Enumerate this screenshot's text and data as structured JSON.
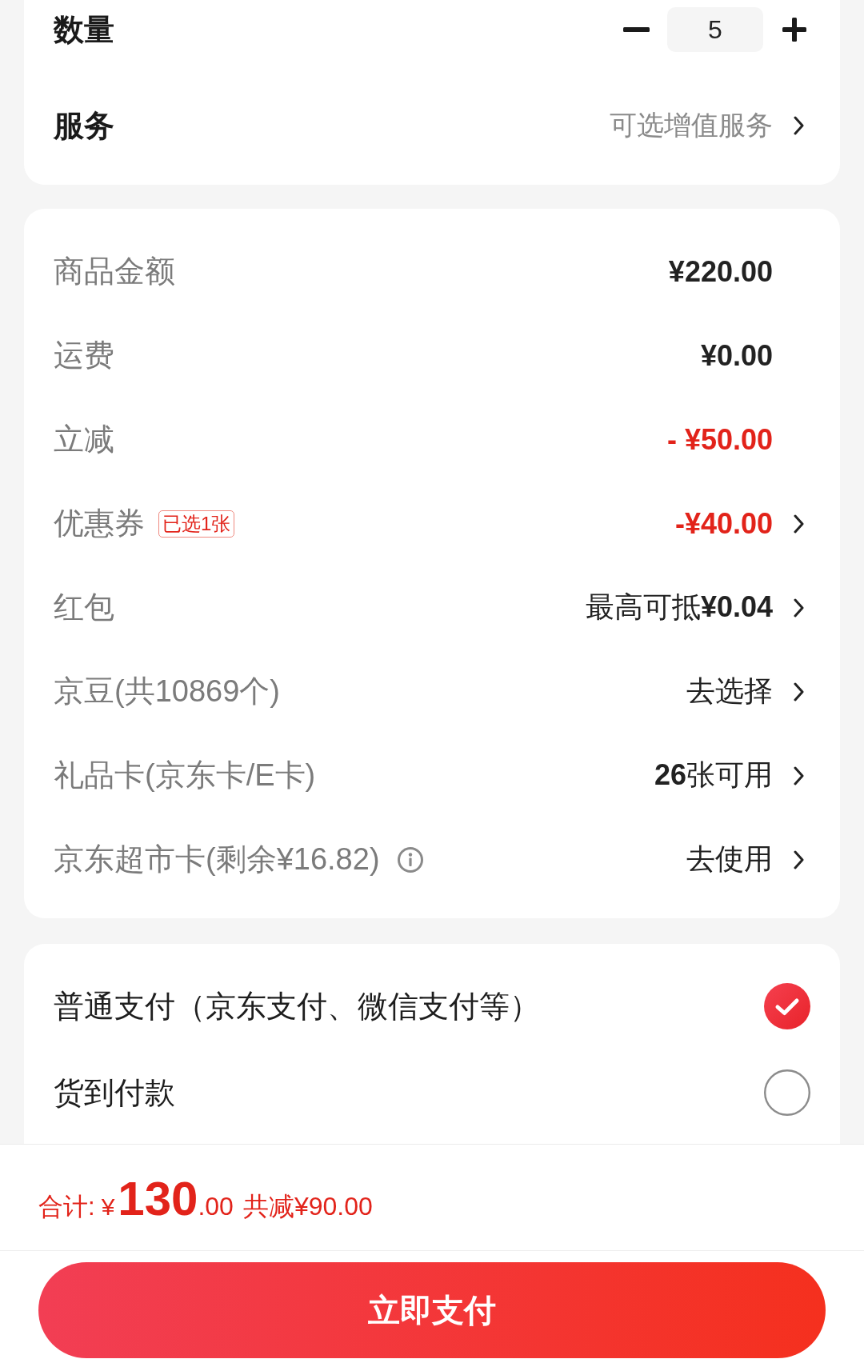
{
  "quantity": {
    "label": "数量",
    "value": "5"
  },
  "service": {
    "label": "服务",
    "value": "可选增值服务"
  },
  "price_rows": [
    {
      "label": "商品金额",
      "value": "¥220.00",
      "kind": "amount",
      "arrow": false,
      "info": false
    },
    {
      "label": "运费",
      "value": "¥0.00",
      "kind": "amount",
      "arrow": false,
      "info": false
    },
    {
      "label": "立减",
      "value": "- ¥50.00",
      "kind": "discount",
      "arrow": false,
      "info": false
    },
    {
      "label": "优惠券",
      "badge": "已选1张",
      "value": "-¥40.00",
      "kind": "discount",
      "arrow": true,
      "info": false
    },
    {
      "label": "红包",
      "value": "最高可抵**¥0.04**",
      "kind": "text",
      "arrow": true,
      "info": false
    },
    {
      "label": "京豆(共10869个)",
      "value": "去选择",
      "kind": "text",
      "arrow": true,
      "info": false
    },
    {
      "label": "礼品卡(京东卡/E卡)",
      "value": "**26**张可用",
      "kind": "text",
      "arrow": true,
      "info": false
    },
    {
      "label": "京东超市卡(剩余¥16.82)",
      "value": "去使用",
      "kind": "text",
      "arrow": true,
      "info": true
    }
  ],
  "payment_options": [
    {
      "label": "普通支付（京东支付、微信支付等）",
      "selected": true
    },
    {
      "label": "货到付款",
      "selected": false
    }
  ],
  "total": {
    "label": "合计:",
    "currency": "¥",
    "integer": "130",
    "decimals": ".00",
    "savings": "共减¥90.00"
  },
  "pay_button": "立即支付"
}
